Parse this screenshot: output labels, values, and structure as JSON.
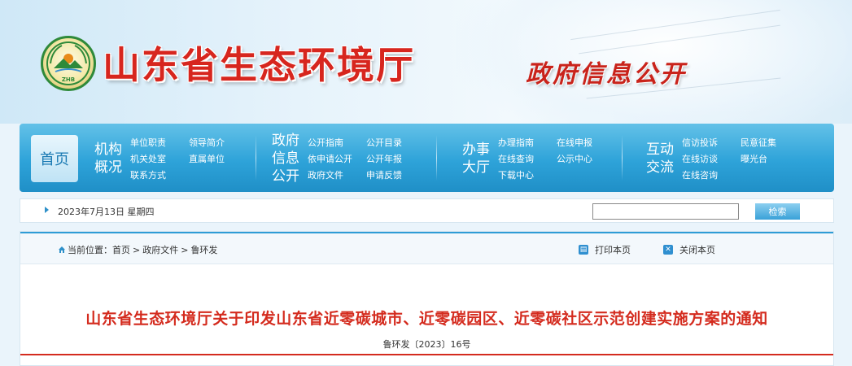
{
  "header": {
    "site_title": "山东省生态环境厅",
    "subtitle": "政府信息公开",
    "emblem_text": "ZHB"
  },
  "nav": {
    "home_label": "首页",
    "groups": [
      {
        "category": [
          "机构",
          "概况"
        ],
        "links": [
          "单位职责",
          "领导简介",
          "机关处室",
          "直属单位",
          "联系方式"
        ]
      },
      {
        "category": [
          "政府",
          "信息",
          "公开"
        ],
        "links": [
          "公开指南",
          "公开目录",
          "依申请公开",
          "公开年报",
          "政府文件",
          "申请反馈"
        ]
      },
      {
        "category": [
          "办事",
          "大厅"
        ],
        "links": [
          "办理指南",
          "在线申报",
          "在线查询",
          "公示中心",
          "下载中心"
        ]
      },
      {
        "category": [
          "互动",
          "交流"
        ],
        "links": [
          "信访投诉",
          "民意征集",
          "在线访谈",
          "曝光台",
          "在线咨询"
        ]
      }
    ]
  },
  "datebar": {
    "date": "2023年7月13日 星期四",
    "search_value": "",
    "search_button": "检索"
  },
  "breadcrumb": {
    "prefix": "当前位置：",
    "items": [
      "首页",
      "政府文件",
      "鲁环发"
    ]
  },
  "tools": {
    "print": "打印本页",
    "close": "关闭本页"
  },
  "document": {
    "title": "山东省生态环境厅关于印发山东省近零碳城市、近零碳园区、近零碳社区示范创建实施方案的通知",
    "number": "鲁环发〔2023〕16号"
  },
  "colors": {
    "title_red": "#d7261e",
    "nav_blue": "#2ea3d9"
  }
}
